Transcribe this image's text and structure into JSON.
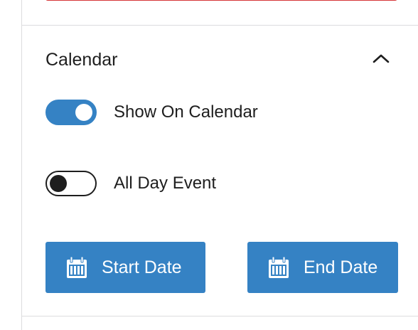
{
  "panel": {
    "title": "Calendar",
    "collapse_icon": "chevron-up-icon",
    "expanded": true
  },
  "toggles": {
    "show_on_calendar": {
      "label": "Show On Calendar",
      "checked": true
    },
    "all_day_event": {
      "label": "All Day Event",
      "checked": false
    }
  },
  "buttons": {
    "start_date": {
      "label": "Start Date",
      "icon": "calendar-icon"
    },
    "end_date": {
      "label": "End Date",
      "icon": "calendar-icon"
    }
  },
  "colors": {
    "primary": "#3582c4",
    "error_border": "#d63638",
    "text": "#1e1e1e",
    "divider": "#dcdcde"
  }
}
